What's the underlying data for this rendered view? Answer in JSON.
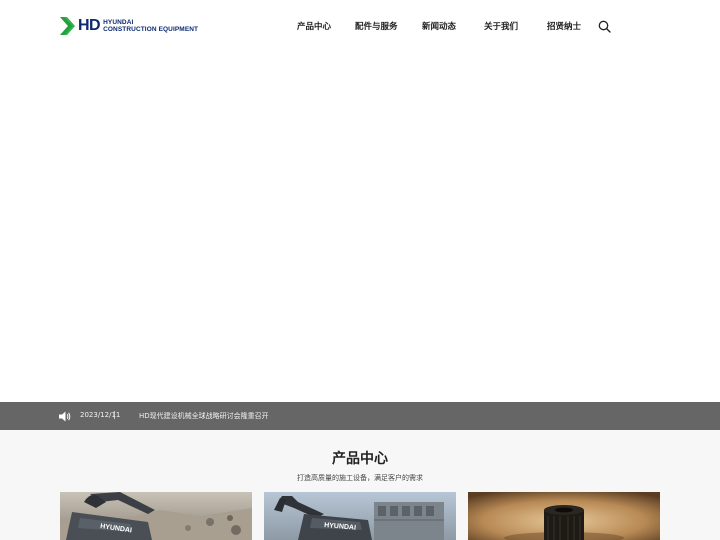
{
  "brand": {
    "logo_hd": "HD",
    "logo_line1": "HYUNDAI",
    "logo_line2": "CONSTRUCTION EQUIPMENT",
    "accent_green": "#2fb34a",
    "navy": "#0b2a6f"
  },
  "nav": {
    "items": [
      {
        "label": "产品中心"
      },
      {
        "label": "配件与服务"
      },
      {
        "label": "新闻动态"
      },
      {
        "label": "关于我们"
      },
      {
        "label": "招贤纳士"
      }
    ],
    "search_icon": "search-icon"
  },
  "news": {
    "icon": "speaker-icon",
    "date": "2023/12/11",
    "separator": "|",
    "title": "HD现代建设机械全球战略研讨会隆重召开",
    "bar_color": "#666666"
  },
  "products": {
    "title": "产品中心",
    "subtitle": "打造高质量的施工设备，满足客户的需求",
    "cards": [
      {
        "name": "excavator-quarry",
        "brand_text": "HYUNDAI"
      },
      {
        "name": "excavator-site",
        "brand_text": "HYUNDAI"
      },
      {
        "name": "parts-filter"
      }
    ]
  }
}
